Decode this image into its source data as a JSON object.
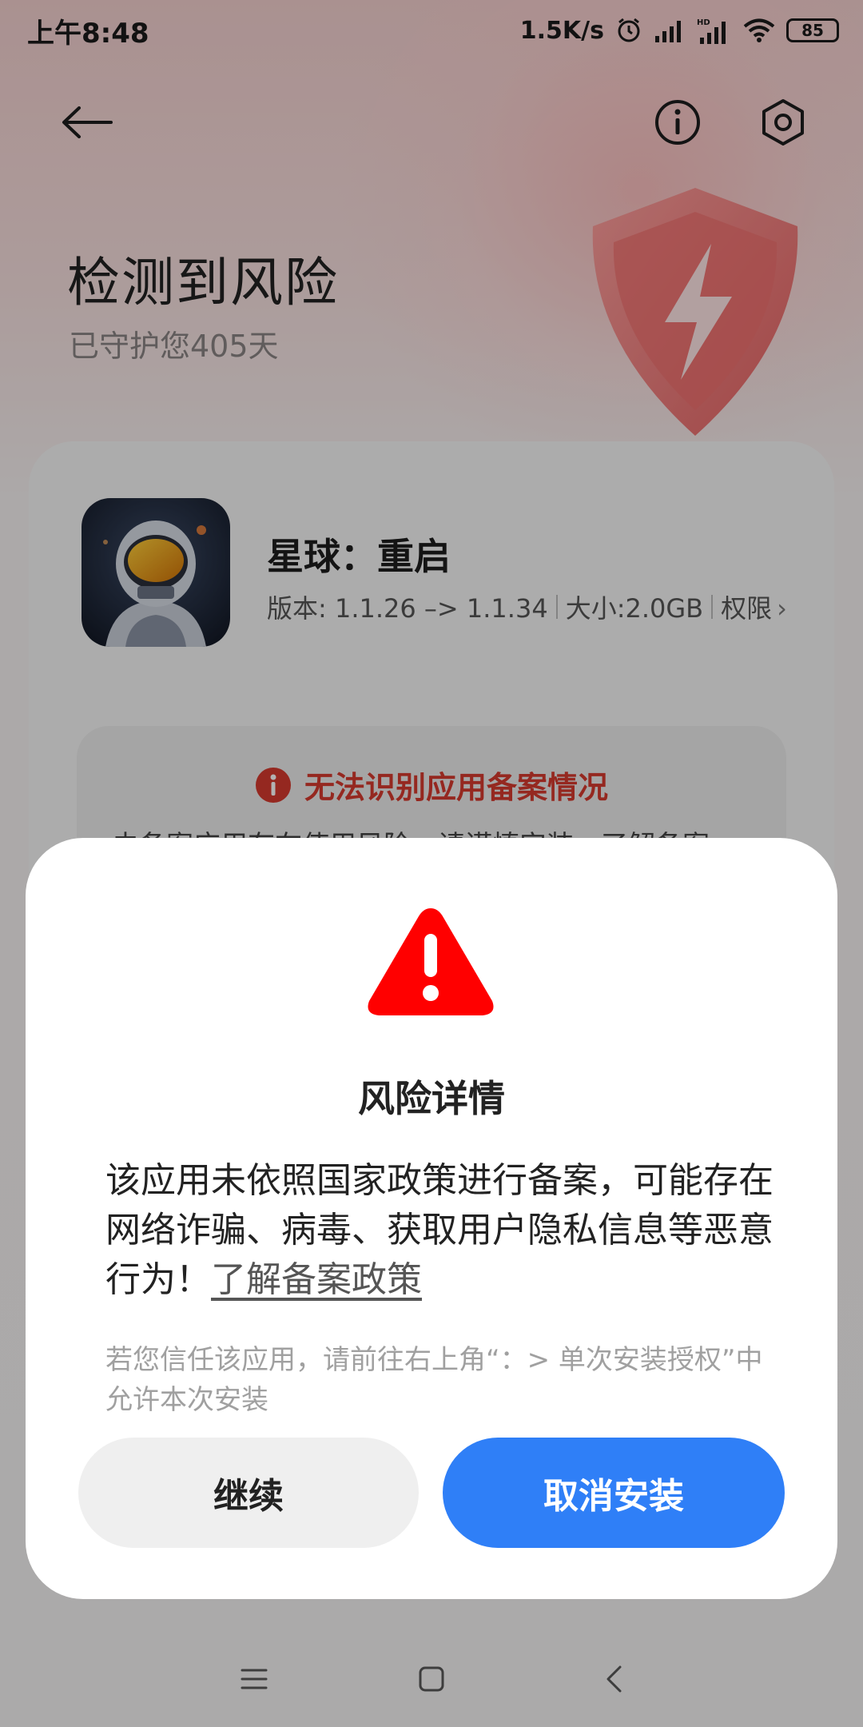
{
  "status_bar": {
    "time": "上午8:48",
    "net_speed": "1.5K/s",
    "battery": "85"
  },
  "header": {
    "title": "检测到风险",
    "subtitle": "已守护您405天"
  },
  "app": {
    "name": "星球：重启",
    "version": "版本: 1.1.26 –> 1.1.34",
    "size": "大小:2.0GB",
    "permissions_label": "权限",
    "permissions_chevron": "›"
  },
  "warning_box": {
    "title": "无法识别应用备案情况",
    "text": "未备案应用存在使用风险，请谨慎安装，了解备案"
  },
  "dialog": {
    "title": "风险详情",
    "message": "该应用未依照国家政策进行备案，可能存在网络诈骗、病毒、获取用户隐私信息等恶意行为！",
    "link": "了解备案政策",
    "hint": "若您信任该应用，请前往右上角“：> 单次安装授权”中允许本次安装",
    "continue_label": "继续",
    "cancel_label": "取消安装"
  },
  "colors": {
    "accent_blue": "#2f7ff7",
    "warning_red": "#d63a2e",
    "alert_red": "#ff0000"
  },
  "icons": [
    "back-arrow-icon",
    "info-icon",
    "settings-icon",
    "shield-icon",
    "alert-icon",
    "menu-icon",
    "home-icon",
    "nav-back-icon"
  ]
}
